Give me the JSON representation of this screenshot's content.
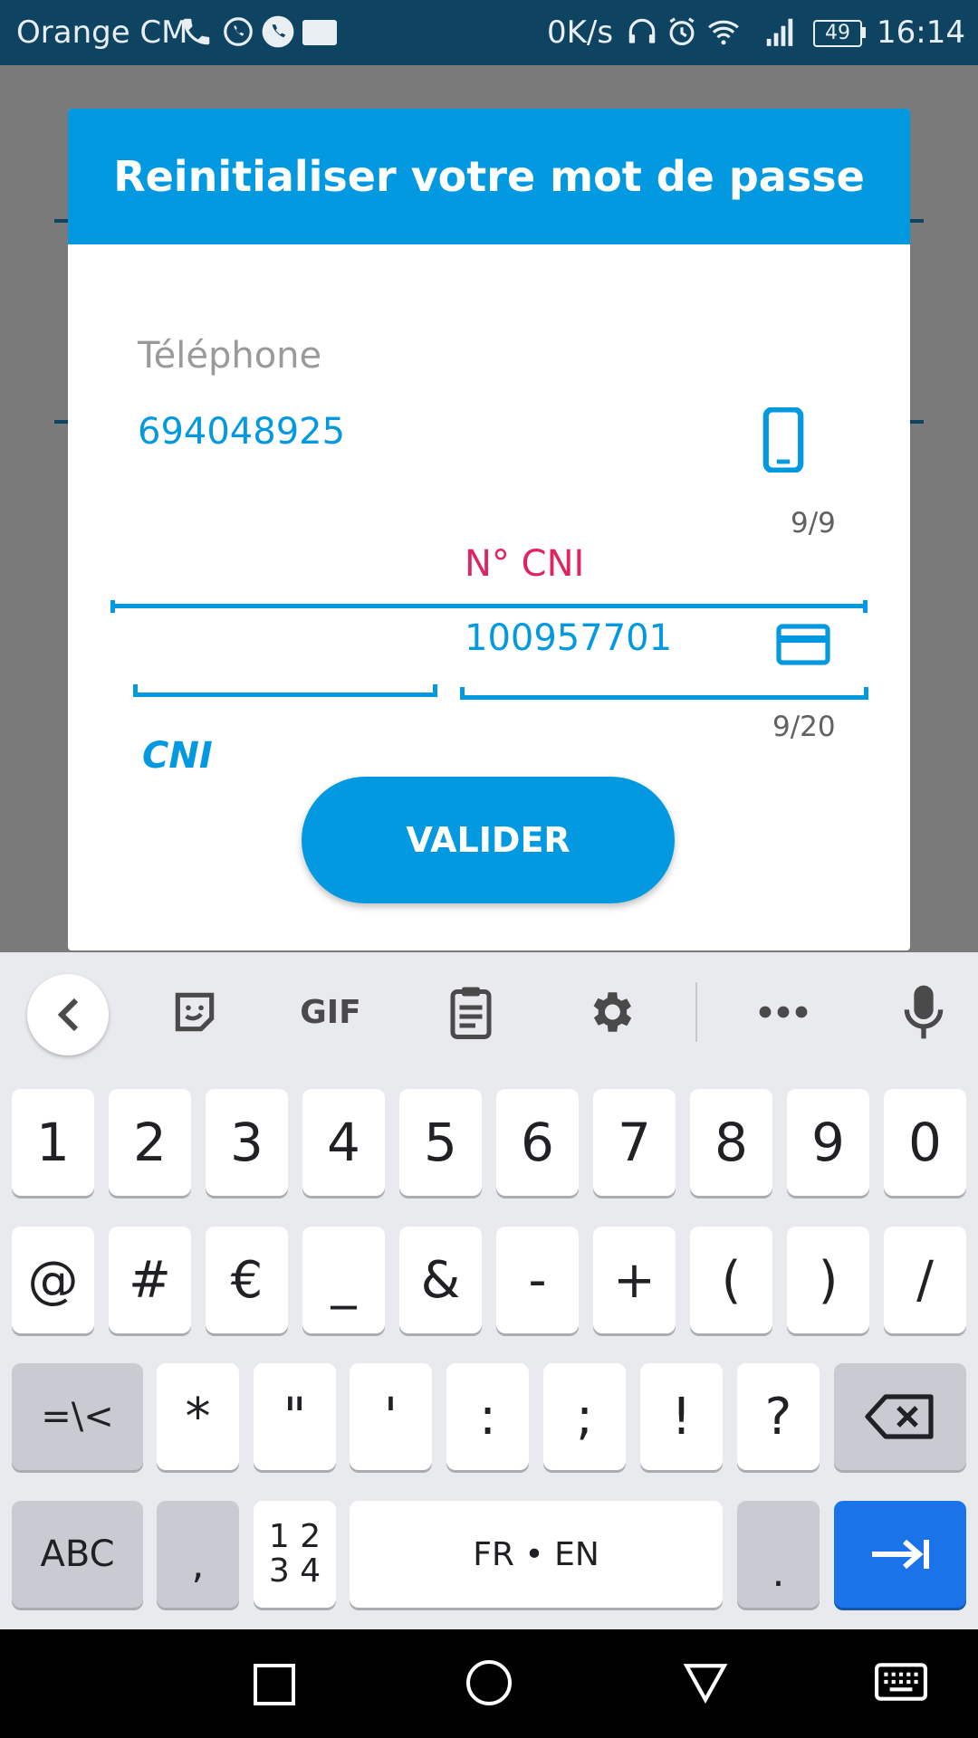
{
  "status_bar": {
    "carrier": "Orange CM",
    "speed": "0K/s",
    "battery": "49",
    "time": "16:14"
  },
  "dialog": {
    "title": "Reinitialiser votre mot de passe",
    "phone_label": "Téléphone",
    "phone_value": "694048925",
    "phone_counter": "9/9",
    "cni_select": "CNI",
    "cni_number_label": "N° CNI",
    "cni_number_value": "100957701",
    "cni_counter": "9/20",
    "submit_label": "VALIDER"
  },
  "keyboard": {
    "gif_label": "GIF",
    "row_numbers": [
      "1",
      "2",
      "3",
      "4",
      "5",
      "6",
      "7",
      "8",
      "9",
      "0"
    ],
    "row_symbols1": [
      "@",
      "#",
      "€",
      "_",
      "&",
      "-",
      "+",
      "(",
      ")",
      "/"
    ],
    "row_symbols2_left": "=\\<",
    "row_symbols2": [
      "*",
      "\"",
      "'",
      ":",
      ";",
      "!",
      "?"
    ],
    "abc_label": "ABC",
    "comma": ",",
    "numpad_top": "1 2",
    "numpad_bottom": "3 4",
    "space_label": "FR • EN",
    "period": "."
  },
  "colors": {
    "accent": "#0299e1",
    "error": "#e0245e",
    "status_bar_bg": "#0e4462",
    "enter_key": "#1a73e8"
  }
}
